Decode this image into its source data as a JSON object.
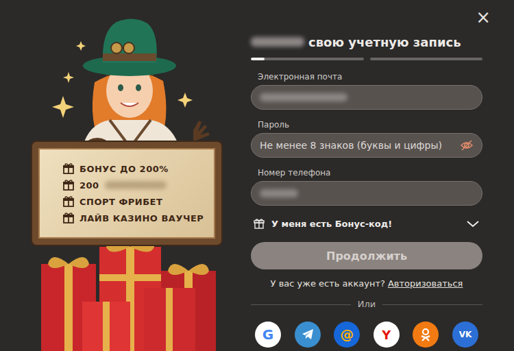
{
  "close": "×",
  "title": {
    "prefix_blurred": true,
    "text": "свою учетную запись"
  },
  "steps": [
    {
      "level": 0.12
    },
    {
      "level": 0
    }
  ],
  "fields": [
    {
      "label": "Электронная почта",
      "kind": "blurred",
      "placeholder": ""
    },
    {
      "label": "Пароль",
      "kind": "password",
      "placeholder": "Не менее 8 знаков (буквы и цифры)"
    },
    {
      "label": "Номер телефона",
      "kind": "blurred",
      "placeholder": ""
    }
  ],
  "bonus_code": {
    "label": "У меня есть Бонус-код!",
    "expanded": false
  },
  "continue_button": {
    "label": "Продолжить",
    "disabled": true
  },
  "login_prompt": {
    "text": "У вас уже есть аккаунт?",
    "link": "Авторизоваться"
  },
  "divider": "Или",
  "social": [
    {
      "kind": "google",
      "glyph": "G"
    },
    {
      "kind": "telegram",
      "glyph": ""
    },
    {
      "kind": "mail",
      "glyph": "@"
    },
    {
      "kind": "yandex",
      "glyph": "Y"
    },
    {
      "kind": "ok",
      "glyph": ""
    },
    {
      "kind": "vk",
      "glyph": "VK"
    }
  ],
  "promo": [
    {
      "text": "БОНУС ДО 200%",
      "blurred_tail": false
    },
    {
      "text": "200",
      "blurred_tail": true
    },
    {
      "text": "СПОРТ ФРИБЕТ",
      "blurred_tail": false
    },
    {
      "text": "ЛАЙВ КАЗИНО ВАУЧЕР",
      "blurred_tail": false
    }
  ]
}
